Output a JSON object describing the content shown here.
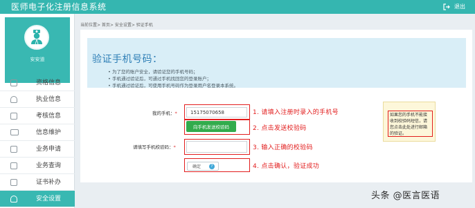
{
  "header": {
    "app_title": "医师电子化注册信息系统",
    "logout_label": "退出"
  },
  "sidebar": {
    "user_name": "安安道",
    "items": [
      {
        "label": "资格信息",
        "icon": "document-icon"
      },
      {
        "label": "执业信息",
        "icon": "headset-icon"
      },
      {
        "label": "考核信息",
        "icon": "checklist-icon"
      },
      {
        "label": "信息维护",
        "icon": "id-card-icon"
      },
      {
        "label": "业务申请",
        "icon": "edit-icon"
      },
      {
        "label": "业务查询",
        "icon": "search-doc-icon"
      },
      {
        "label": "证书补办",
        "icon": "certificate-icon"
      },
      {
        "label": "安全设置",
        "icon": "user-lock-icon",
        "active": true
      }
    ]
  },
  "breadcrumb": "当前位置> 首页> 安全设置> 验证手机",
  "info": {
    "title": "验证手机号码：",
    "items": [
      "为了您的账户安全，请验证您的手机号码；",
      "手机通过验证后，可通过手机找回您的登录账户；",
      "手机通过验证后，可使用手机号码作为登录用户名登录本系统。"
    ]
  },
  "form": {
    "phone_label": "我的手机：",
    "phone_value": "15175070658",
    "send_code_label": "向手机发送校验码",
    "code_label": "请填写手机校验码：",
    "confirm_label": "确定",
    "confirm_badge": "?"
  },
  "steps": [
    "1. 请填入注册时录入的手机号",
    "2. 点击发送校验码",
    "3. 输入正确的校验码",
    "4. 点击确认，验证成功"
  ],
  "notice": "如果您的手机不能接收到校验码短信，请您点击此处进行邮箱的验证。",
  "watermark": "头条 @医言医语",
  "colors": {
    "topbar": "#35b6b0",
    "annotation_red": "#e21c1c",
    "send_button": "#32ab4c",
    "info_title": "#2f7fb6"
  }
}
